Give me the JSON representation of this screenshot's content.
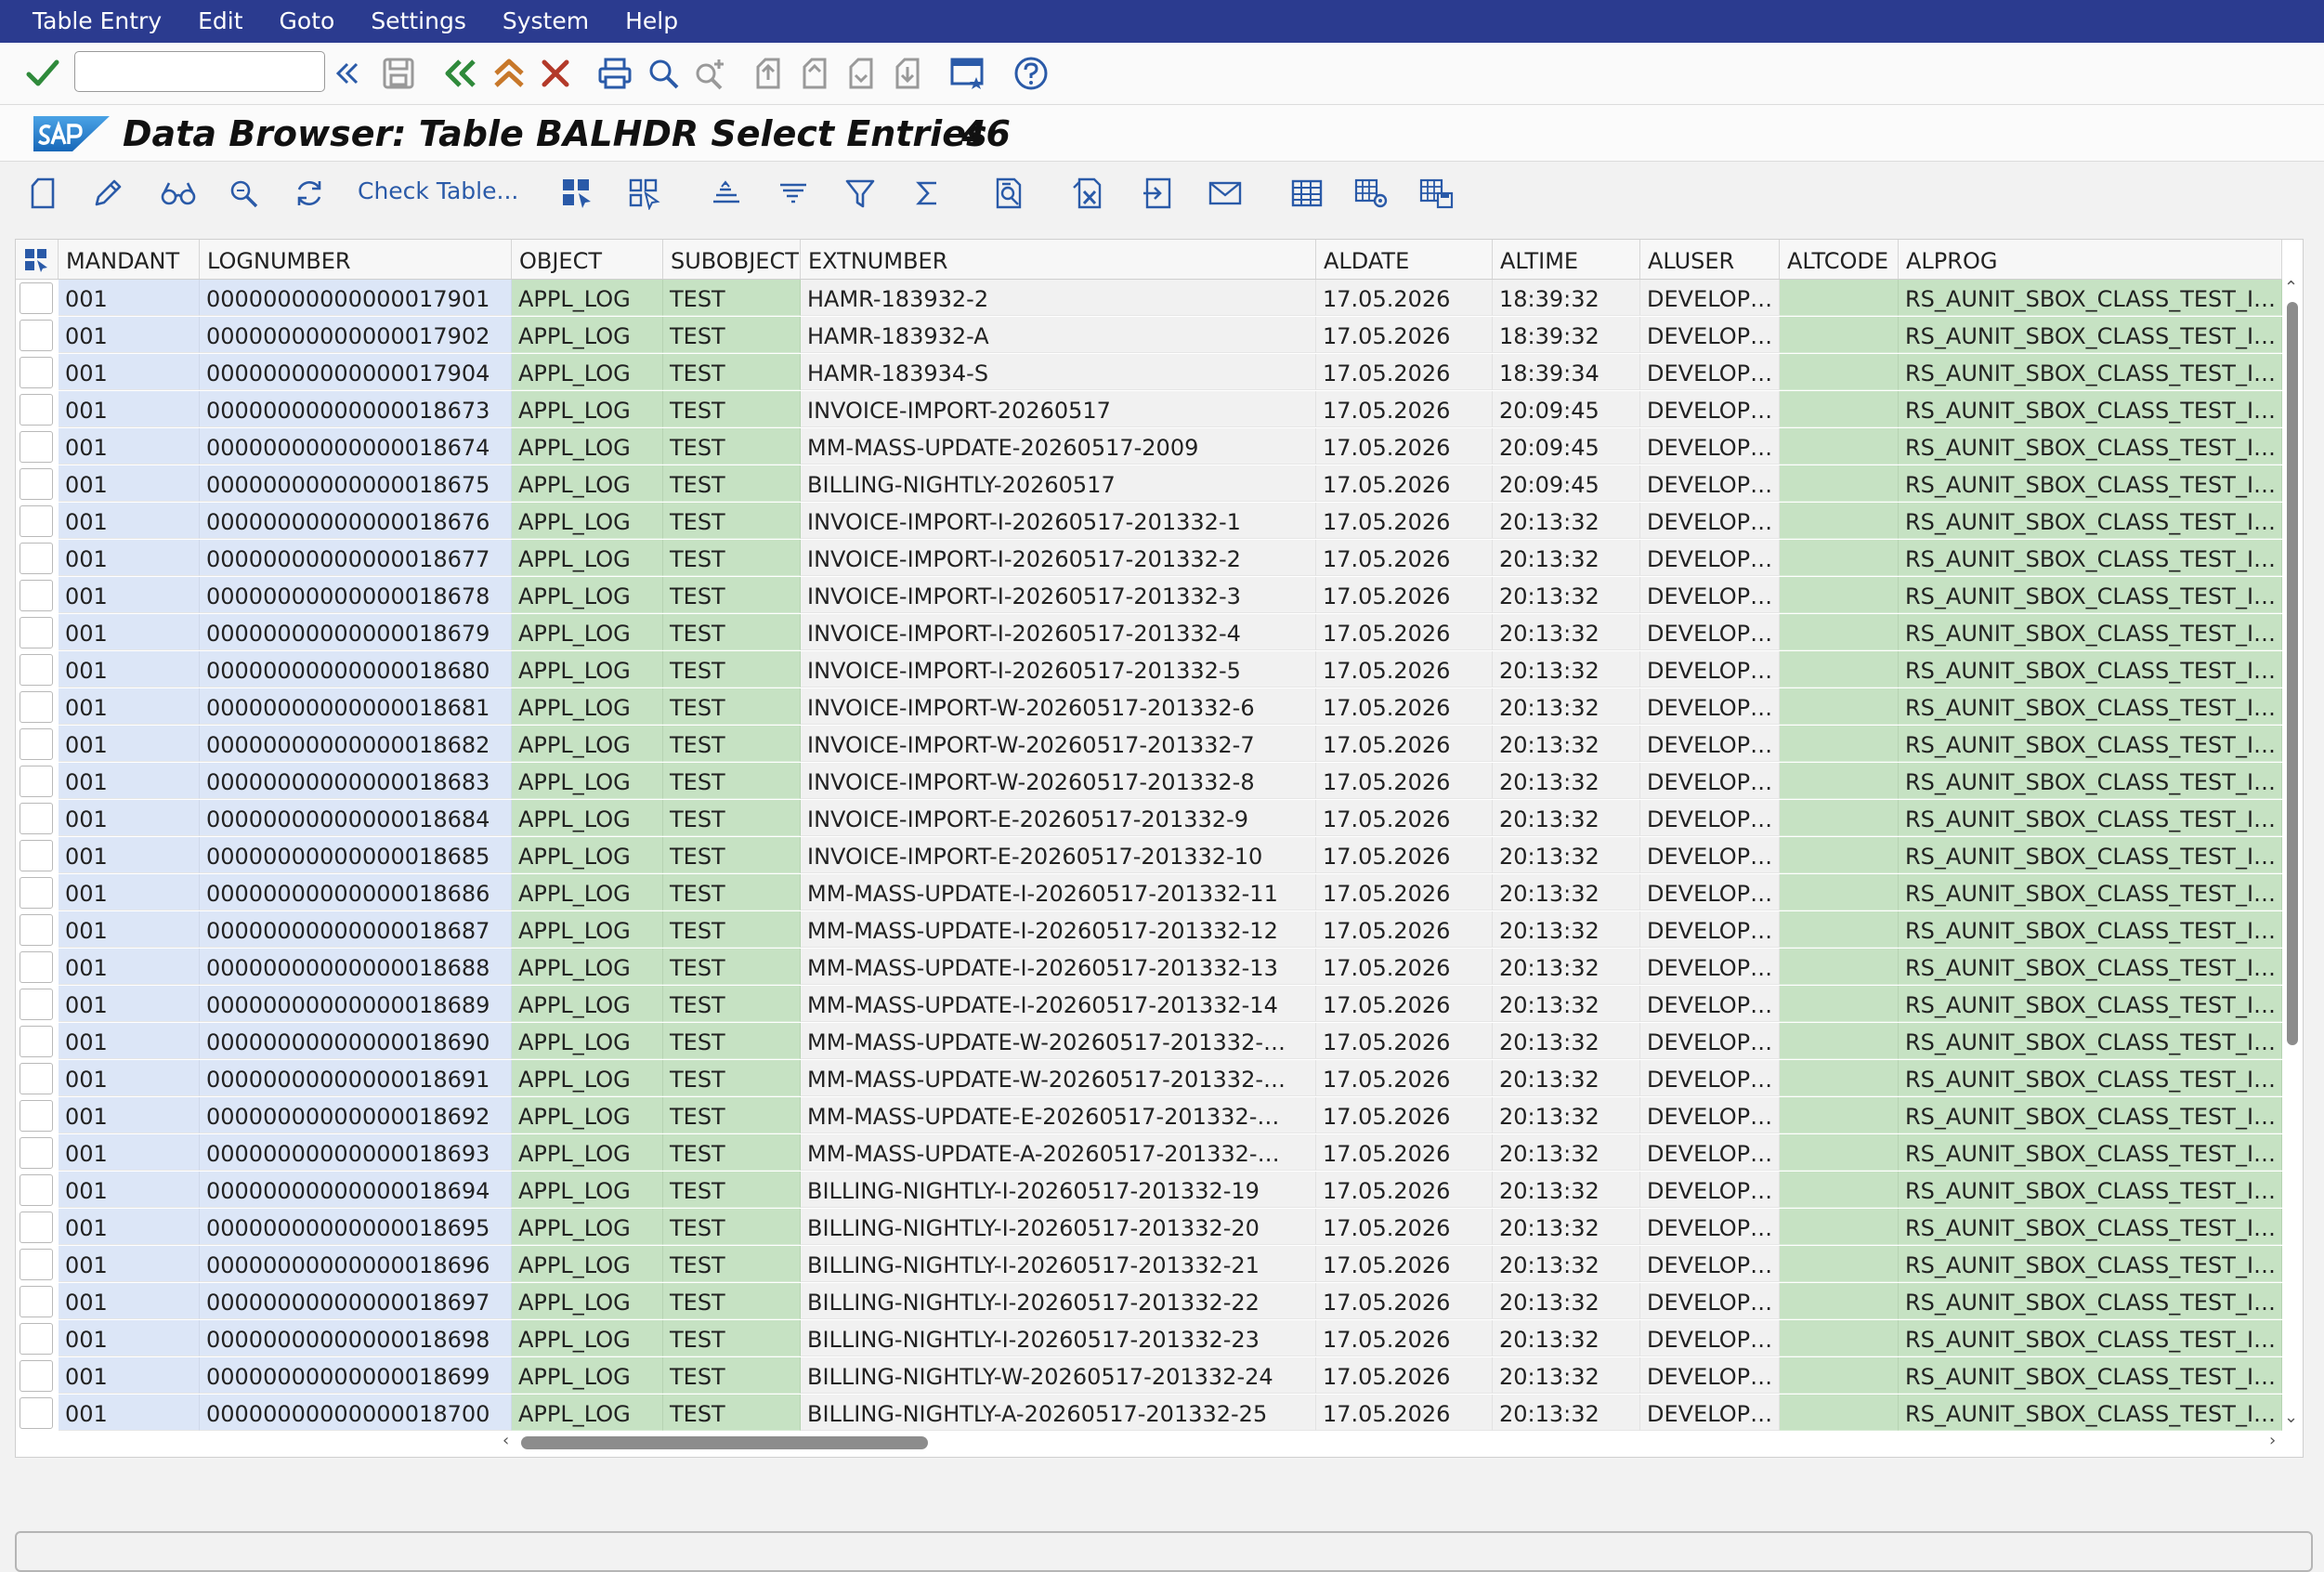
{
  "menu": [
    "Table Entry",
    "Edit",
    "Goto",
    "Settings",
    "System",
    "Help"
  ],
  "title": {
    "text": "Data Browser: Table BALHDR Select Entries",
    "count": "46"
  },
  "app_toolbar": {
    "check_table_label": "Check Table..."
  },
  "columns": [
    "MANDANT",
    "LOGNUMBER",
    "OBJECT",
    "SUBOBJECT",
    "EXTNUMBER",
    "ALDATE",
    "ALTIME",
    "ALUSER",
    "ALTCODE",
    "ALPROG"
  ],
  "rows": [
    [
      "001",
      "00000000000000017901",
      "APPL_LOG",
      "TEST",
      "HAMR-183932-2",
      "17.05.2026",
      "18:39:32",
      "DEVELOPER",
      "",
      "RS_AUNIT_SBOX_CLASS_TEST_INT"
    ],
    [
      "001",
      "00000000000000017902",
      "APPL_LOG",
      "TEST",
      "HAMR-183932-A",
      "17.05.2026",
      "18:39:32",
      "DEVELOPER",
      "",
      "RS_AUNIT_SBOX_CLASS_TEST_INT"
    ],
    [
      "001",
      "00000000000000017904",
      "APPL_LOG",
      "TEST",
      "HAMR-183934-S",
      "17.05.2026",
      "18:39:34",
      "DEVELOPER",
      "",
      "RS_AUNIT_SBOX_CLASS_TEST_INT"
    ],
    [
      "001",
      "00000000000000018673",
      "APPL_LOG",
      "TEST",
      "INVOICE-IMPORT-20260517",
      "17.05.2026",
      "20:09:45",
      "DEVELOPER",
      "",
      "RS_AUNIT_SBOX_CLASS_TEST_INT"
    ],
    [
      "001",
      "00000000000000018674",
      "APPL_LOG",
      "TEST",
      "MM-MASS-UPDATE-20260517-2009",
      "17.05.2026",
      "20:09:45",
      "DEVELOPER",
      "",
      "RS_AUNIT_SBOX_CLASS_TEST_INT"
    ],
    [
      "001",
      "00000000000000018675",
      "APPL_LOG",
      "TEST",
      "BILLING-NIGHTLY-20260517",
      "17.05.2026",
      "20:09:45",
      "DEVELOPER",
      "",
      "RS_AUNIT_SBOX_CLASS_TEST_INT"
    ],
    [
      "001",
      "00000000000000018676",
      "APPL_LOG",
      "TEST",
      "INVOICE-IMPORT-I-20260517-201332-1",
      "17.05.2026",
      "20:13:32",
      "DEVELOPER",
      "",
      "RS_AUNIT_SBOX_CLASS_TEST_INT"
    ],
    [
      "001",
      "00000000000000018677",
      "APPL_LOG",
      "TEST",
      "INVOICE-IMPORT-I-20260517-201332-2",
      "17.05.2026",
      "20:13:32",
      "DEVELOPER",
      "",
      "RS_AUNIT_SBOX_CLASS_TEST_INT"
    ],
    [
      "001",
      "00000000000000018678",
      "APPL_LOG",
      "TEST",
      "INVOICE-IMPORT-I-20260517-201332-3",
      "17.05.2026",
      "20:13:32",
      "DEVELOPER",
      "",
      "RS_AUNIT_SBOX_CLASS_TEST_INT"
    ],
    [
      "001",
      "00000000000000018679",
      "APPL_LOG",
      "TEST",
      "INVOICE-IMPORT-I-20260517-201332-4",
      "17.05.2026",
      "20:13:32",
      "DEVELOPER",
      "",
      "RS_AUNIT_SBOX_CLASS_TEST_INT"
    ],
    [
      "001",
      "00000000000000018680",
      "APPL_LOG",
      "TEST",
      "INVOICE-IMPORT-I-20260517-201332-5",
      "17.05.2026",
      "20:13:32",
      "DEVELOPER",
      "",
      "RS_AUNIT_SBOX_CLASS_TEST_INT"
    ],
    [
      "001",
      "00000000000000018681",
      "APPL_LOG",
      "TEST",
      "INVOICE-IMPORT-W-20260517-201332-6",
      "17.05.2026",
      "20:13:32",
      "DEVELOPER",
      "",
      "RS_AUNIT_SBOX_CLASS_TEST_INT"
    ],
    [
      "001",
      "00000000000000018682",
      "APPL_LOG",
      "TEST",
      "INVOICE-IMPORT-W-20260517-201332-7",
      "17.05.2026",
      "20:13:32",
      "DEVELOPER",
      "",
      "RS_AUNIT_SBOX_CLASS_TEST_INT"
    ],
    [
      "001",
      "00000000000000018683",
      "APPL_LOG",
      "TEST",
      "INVOICE-IMPORT-W-20260517-201332-8",
      "17.05.2026",
      "20:13:32",
      "DEVELOPER",
      "",
      "RS_AUNIT_SBOX_CLASS_TEST_INT"
    ],
    [
      "001",
      "00000000000000018684",
      "APPL_LOG",
      "TEST",
      "INVOICE-IMPORT-E-20260517-201332-9",
      "17.05.2026",
      "20:13:32",
      "DEVELOPER",
      "",
      "RS_AUNIT_SBOX_CLASS_TEST_INT"
    ],
    [
      "001",
      "00000000000000018685",
      "APPL_LOG",
      "TEST",
      "INVOICE-IMPORT-E-20260517-201332-10",
      "17.05.2026",
      "20:13:32",
      "DEVELOPER",
      "",
      "RS_AUNIT_SBOX_CLASS_TEST_INT"
    ],
    [
      "001",
      "00000000000000018686",
      "APPL_LOG",
      "TEST",
      "MM-MASS-UPDATE-I-20260517-201332-11",
      "17.05.2026",
      "20:13:32",
      "DEVELOPER",
      "",
      "RS_AUNIT_SBOX_CLASS_TEST_INT"
    ],
    [
      "001",
      "00000000000000018687",
      "APPL_LOG",
      "TEST",
      "MM-MASS-UPDATE-I-20260517-201332-12",
      "17.05.2026",
      "20:13:32",
      "DEVELOPER",
      "",
      "RS_AUNIT_SBOX_CLASS_TEST_INT"
    ],
    [
      "001",
      "00000000000000018688",
      "APPL_LOG",
      "TEST",
      "MM-MASS-UPDATE-I-20260517-201332-13",
      "17.05.2026",
      "20:13:32",
      "DEVELOPER",
      "",
      "RS_AUNIT_SBOX_CLASS_TEST_INT"
    ],
    [
      "001",
      "00000000000000018689",
      "APPL_LOG",
      "TEST",
      "MM-MASS-UPDATE-I-20260517-201332-14",
      "17.05.2026",
      "20:13:32",
      "DEVELOPER",
      "",
      "RS_AUNIT_SBOX_CLASS_TEST_INT"
    ],
    [
      "001",
      "00000000000000018690",
      "APPL_LOG",
      "TEST",
      "MM-MASS-UPDATE-W-20260517-201332-…",
      "17.05.2026",
      "20:13:32",
      "DEVELOPER",
      "",
      "RS_AUNIT_SBOX_CLASS_TEST_INT"
    ],
    [
      "001",
      "00000000000000018691",
      "APPL_LOG",
      "TEST",
      "MM-MASS-UPDATE-W-20260517-201332-…",
      "17.05.2026",
      "20:13:32",
      "DEVELOPER",
      "",
      "RS_AUNIT_SBOX_CLASS_TEST_INT"
    ],
    [
      "001",
      "00000000000000018692",
      "APPL_LOG",
      "TEST",
      "MM-MASS-UPDATE-E-20260517-201332-…",
      "17.05.2026",
      "20:13:32",
      "DEVELOPER",
      "",
      "RS_AUNIT_SBOX_CLASS_TEST_INT"
    ],
    [
      "001",
      "00000000000000018693",
      "APPL_LOG",
      "TEST",
      "MM-MASS-UPDATE-A-20260517-201332-…",
      "17.05.2026",
      "20:13:32",
      "DEVELOPER",
      "",
      "RS_AUNIT_SBOX_CLASS_TEST_INT"
    ],
    [
      "001",
      "00000000000000018694",
      "APPL_LOG",
      "TEST",
      "BILLING-NIGHTLY-I-20260517-201332-19",
      "17.05.2026",
      "20:13:32",
      "DEVELOPER",
      "",
      "RS_AUNIT_SBOX_CLASS_TEST_INT"
    ],
    [
      "001",
      "00000000000000018695",
      "APPL_LOG",
      "TEST",
      "BILLING-NIGHTLY-I-20260517-201332-20",
      "17.05.2026",
      "20:13:32",
      "DEVELOPER",
      "",
      "RS_AUNIT_SBOX_CLASS_TEST_INT"
    ],
    [
      "001",
      "00000000000000018696",
      "APPL_LOG",
      "TEST",
      "BILLING-NIGHTLY-I-20260517-201332-21",
      "17.05.2026",
      "20:13:32",
      "DEVELOPER",
      "",
      "RS_AUNIT_SBOX_CLASS_TEST_INT"
    ],
    [
      "001",
      "00000000000000018697",
      "APPL_LOG",
      "TEST",
      "BILLING-NIGHTLY-I-20260517-201332-22",
      "17.05.2026",
      "20:13:32",
      "DEVELOPER",
      "",
      "RS_AUNIT_SBOX_CLASS_TEST_INT"
    ],
    [
      "001",
      "00000000000000018698",
      "APPL_LOG",
      "TEST",
      "BILLING-NIGHTLY-I-20260517-201332-23",
      "17.05.2026",
      "20:13:32",
      "DEVELOPER",
      "",
      "RS_AUNIT_SBOX_CLASS_TEST_INT"
    ],
    [
      "001",
      "00000000000000018699",
      "APPL_LOG",
      "TEST",
      "BILLING-NIGHTLY-W-20260517-201332-24",
      "17.05.2026",
      "20:13:32",
      "DEVELOPER",
      "",
      "RS_AUNIT_SBOX_CLASS_TEST_INT"
    ],
    [
      "001",
      "00000000000000018700",
      "APPL_LOG",
      "TEST",
      "BILLING-NIGHTLY-A-20260517-201332-25",
      "17.05.2026",
      "20:13:32",
      "DEVELOPER",
      "",
      "RS_AUNIT_SBOX_CLASS_TEST_INT"
    ]
  ],
  "colors": {
    "menu_bg": "#2b3b8f",
    "key_cells": "#dce6f7",
    "data_cells": "#c6e2c3",
    "icon_blue": "#2a5aa8",
    "exit_red": "#b33a2a",
    "back_green": "#2f8a3b"
  }
}
